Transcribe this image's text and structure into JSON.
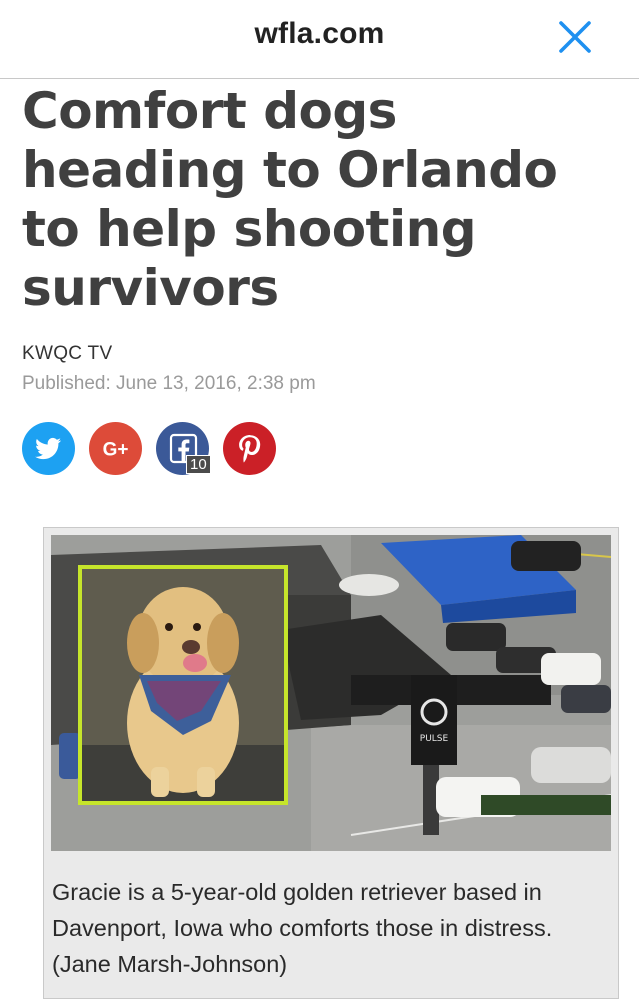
{
  "browser": {
    "domain": "wfla.com",
    "close_icon": "close-x-icon"
  },
  "article": {
    "headline": "Comfort dogs heading to Orlando to help shooting survivors",
    "source": "KWQC TV",
    "published": "Published: June 13, 2016, 2:38 pm"
  },
  "share": {
    "buttons": [
      {
        "network": "twitter",
        "icon": "twitter-bird-icon",
        "color": "#1da1f2"
      },
      {
        "network": "google-plus",
        "icon": "google-plus-icon",
        "label": "G+",
        "color": "#dd4b39"
      },
      {
        "network": "facebook",
        "icon": "facebook-f-icon",
        "color": "#3b5998"
      },
      {
        "network": "pinterest",
        "icon": "pinterest-p-icon",
        "color": "#cb2027"
      }
    ],
    "facebook_count": "10"
  },
  "figure": {
    "photo_sign_text": "PULSE",
    "caption": "Gracie is a 5-year-old golden retriever based in Davenport, Iowa who comforts those in distress. (Jane Marsh-Johnson)",
    "inset_border_color": "#c6e52b"
  }
}
